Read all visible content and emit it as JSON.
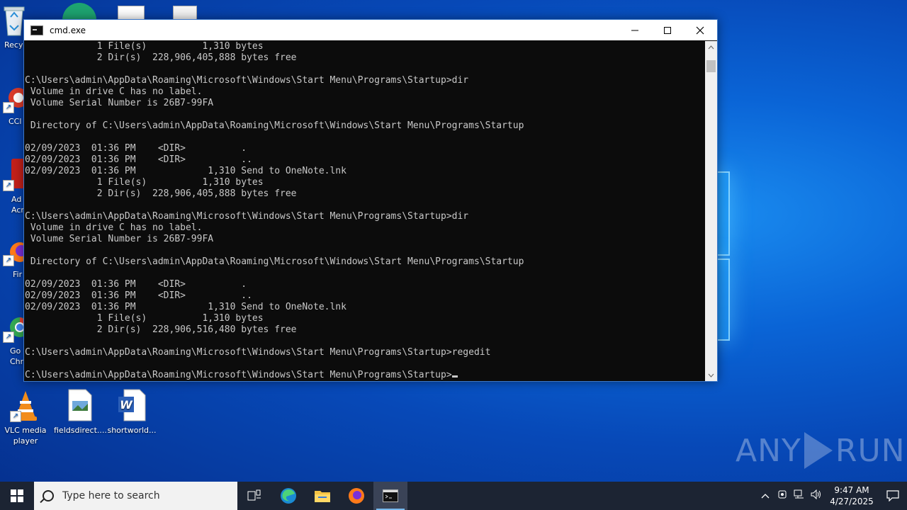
{
  "desktop": {
    "icons": [
      {
        "label": "Recy",
        "icon": "recycle-bin-icon"
      },
      {
        "label": "CCl",
        "icon": "ccleaner-icon"
      },
      {
        "label": "Ad Acr",
        "icon": "adobe-acrobat-icon"
      },
      {
        "label": "Fir",
        "icon": "firefox-icon"
      },
      {
        "label": "Go Chr",
        "icon": "chrome-icon"
      },
      {
        "label": "VLC media player",
        "icon": "vlc-icon"
      },
      {
        "label": "fieldsdirect....",
        "icon": "image-file-icon"
      },
      {
        "label": "shortworld...",
        "icon": "word-document-icon"
      }
    ]
  },
  "window": {
    "title": "cmd.exe",
    "minimize": "—",
    "maximize": "☐",
    "close": "✕",
    "console_lines": [
      "             1 File(s)          1,310 bytes",
      "             2 Dir(s)  228,906,405,888 bytes free",
      "",
      "C:\\Users\\admin\\AppData\\Roaming\\Microsoft\\Windows\\Start Menu\\Programs\\Startup>dir",
      " Volume in drive C has no label.",
      " Volume Serial Number is 26B7-99FA",
      "",
      " Directory of C:\\Users\\admin\\AppData\\Roaming\\Microsoft\\Windows\\Start Menu\\Programs\\Startup",
      "",
      "02/09/2023  01:36 PM    <DIR>          .",
      "02/09/2023  01:36 PM    <DIR>          ..",
      "02/09/2023  01:36 PM             1,310 Send to OneNote.lnk",
      "             1 File(s)          1,310 bytes",
      "             2 Dir(s)  228,906,405,888 bytes free",
      "",
      "C:\\Users\\admin\\AppData\\Roaming\\Microsoft\\Windows\\Start Menu\\Programs\\Startup>dir",
      " Volume in drive C has no label.",
      " Volume Serial Number is 26B7-99FA",
      "",
      " Directory of C:\\Users\\admin\\AppData\\Roaming\\Microsoft\\Windows\\Start Menu\\Programs\\Startup",
      "",
      "02/09/2023  01:36 PM    <DIR>          .",
      "02/09/2023  01:36 PM    <DIR>          ..",
      "02/09/2023  01:36 PM             1,310 Send to OneNote.lnk",
      "             1 File(s)          1,310 bytes",
      "             2 Dir(s)  228,906,516,480 bytes free",
      "",
      "C:\\Users\\admin\\AppData\\Roaming\\Microsoft\\Windows\\Start Menu\\Programs\\Startup>regedit",
      ""
    ],
    "prompt": "C:\\Users\\admin\\AppData\\Roaming\\Microsoft\\Windows\\Start Menu\\Programs\\Startup>"
  },
  "watermark": {
    "left": "ANY",
    "right": "RUN"
  },
  "taskbar": {
    "search_placeholder": "Type here to search",
    "apps": [
      "task-view-icon",
      "edge-icon",
      "file-explorer-icon",
      "firefox-icon",
      "cmd-icon"
    ],
    "tray": {
      "chevron": "^",
      "time": "9:47 AM",
      "date": "4/27/2025"
    }
  },
  "colors": {
    "console_bg": "#0c0c0c",
    "console_fg": "#c8c8c8",
    "taskbar_bg": "#1c2433",
    "desktop_blue": "#0a64d6"
  }
}
